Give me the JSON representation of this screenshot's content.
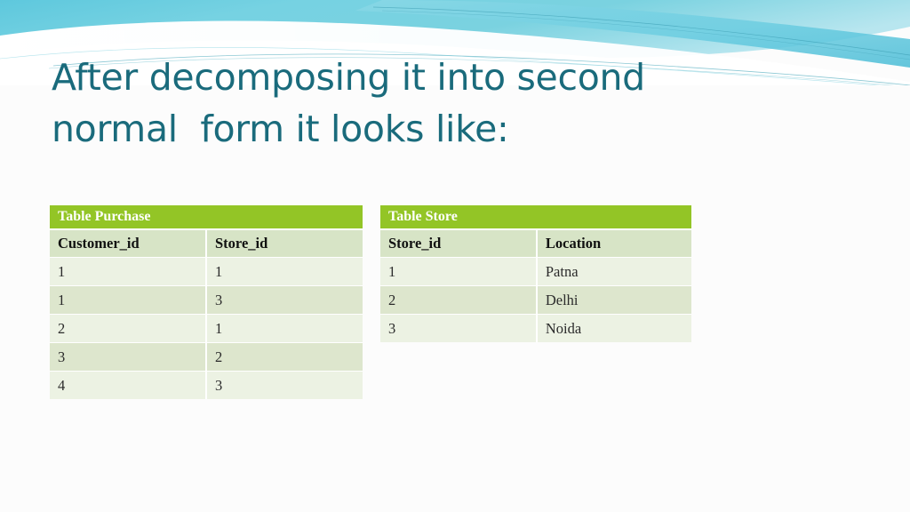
{
  "slide": {
    "background_color": "#fcfcfc",
    "accent_teal": "#1a6b7c",
    "wave_cyan_light": "#aee3ee",
    "wave_cyan_mid": "#6fcde0",
    "wave_cyan_deep": "#4fc3d8",
    "table_header_green": "#93c526",
    "table_colhead_green": "#d7e4c6",
    "row_light": "#ecf2e3",
    "row_dark": "#dde6cd"
  },
  "title": {
    "line1": "After decomposing it into second",
    "line2": "normal  form it looks like:"
  },
  "tables": [
    {
      "id": "purchase",
      "caption": "Table Purchase",
      "columns": [
        "Customer_id",
        "Store_id"
      ],
      "rows": [
        [
          "1",
          "1"
        ],
        [
          "1",
          "3"
        ],
        [
          "2",
          "1"
        ],
        [
          "3",
          "2"
        ],
        [
          "4",
          "3"
        ]
      ]
    },
    {
      "id": "store",
      "caption": "Table Store",
      "columns": [
        "Store_id",
        "Location"
      ],
      "rows": [
        [
          "1",
          "Patna"
        ],
        [
          "2",
          "Delhi"
        ],
        [
          "3",
          "Noida"
        ]
      ]
    }
  ]
}
